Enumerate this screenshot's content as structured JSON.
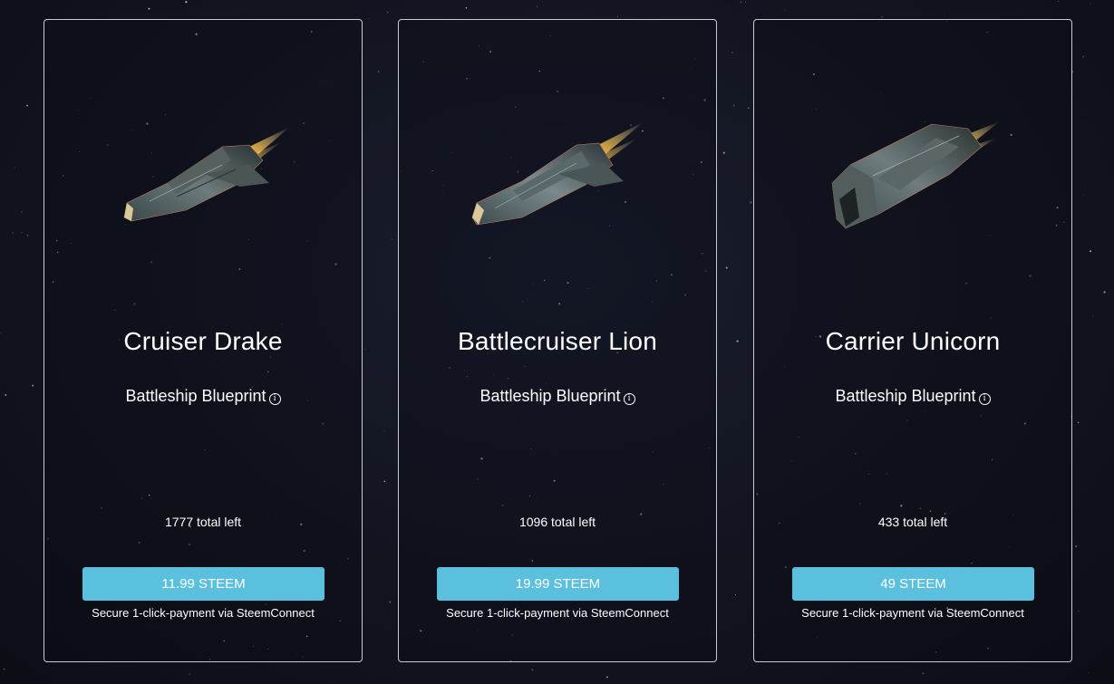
{
  "products": [
    {
      "name": "Cruiser Drake",
      "type": "Battleship Blueprint",
      "info_icon": "info-icon",
      "remaining": "1777 total left",
      "price": "11.99 STEEM",
      "payment_note": "Secure 1-click-payment via SteemConnect"
    },
    {
      "name": "Battlecruiser Lion",
      "type": "Battleship Blueprint",
      "info_icon": "info-icon",
      "remaining": "1096 total left",
      "price": "19.99 STEEM",
      "payment_note": "Secure 1-click-payment via SteemConnect"
    },
    {
      "name": "Carrier Unicorn",
      "type": "Battleship Blueprint",
      "info_icon": "info-icon",
      "remaining": "433 total left",
      "price": "49 STEEM",
      "payment_note": "Secure 1-click-payment via SteemConnect"
    }
  ],
  "colors": {
    "button": "#5bc0de",
    "card_border": "#c9cbd3",
    "background": "#121420"
  }
}
